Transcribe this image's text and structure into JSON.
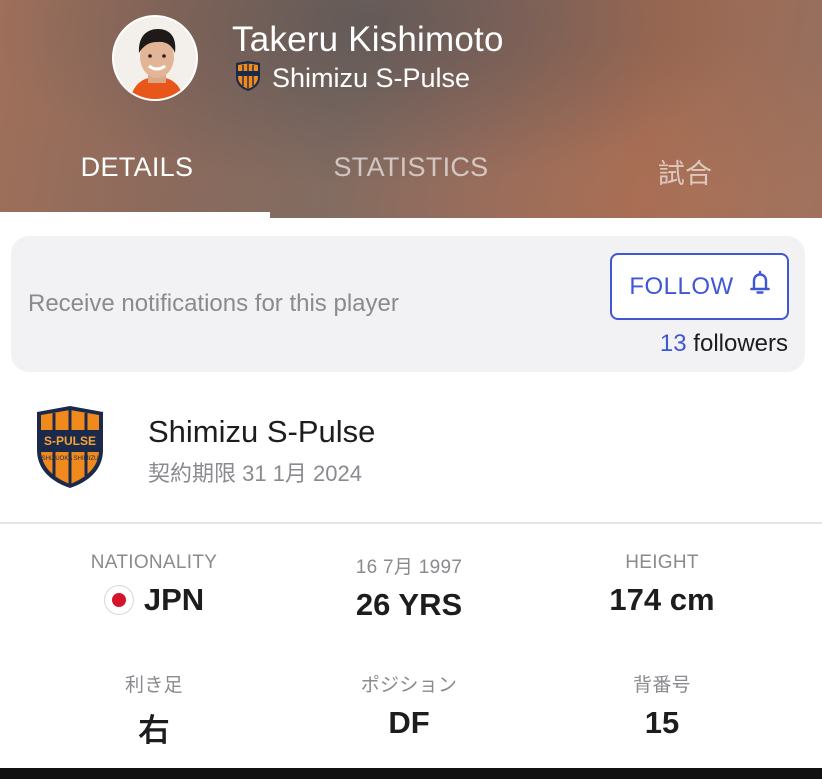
{
  "player": {
    "name": "Takeru Kishimoto",
    "team": "Shimizu S-Pulse"
  },
  "tabs": [
    {
      "label": "DETAILS",
      "active": true
    },
    {
      "label": "STATISTICS",
      "active": false
    },
    {
      "label": "試合",
      "active": false
    }
  ],
  "follow": {
    "prompt": "Receive notifications for this player",
    "button_label": "FOLLOW",
    "button_icon": "bell-icon",
    "followers_count": "13",
    "followers_label": "followers"
  },
  "club": {
    "name": "Shimizu S-Pulse",
    "contract": "契約期限 31 1月 2024",
    "logo_text": "S-PULSE",
    "logo_subtext": "SHIZUOKA SHIMIZU"
  },
  "stats": [
    {
      "label": "NATIONALITY",
      "value": "JPN",
      "icon": "japan-flag-icon"
    },
    {
      "label": "16 7月 1997",
      "value": "26 YRS"
    },
    {
      "label": "HEIGHT",
      "value": "174 cm"
    },
    {
      "label": "利き足",
      "value": "右"
    },
    {
      "label": "ポジション",
      "value": "DF"
    },
    {
      "label": "背番号",
      "value": "15"
    }
  ],
  "colors": {
    "accent": "#3f57d6",
    "club_orange": "#f08a1c",
    "club_navy": "#1b2a4a"
  }
}
